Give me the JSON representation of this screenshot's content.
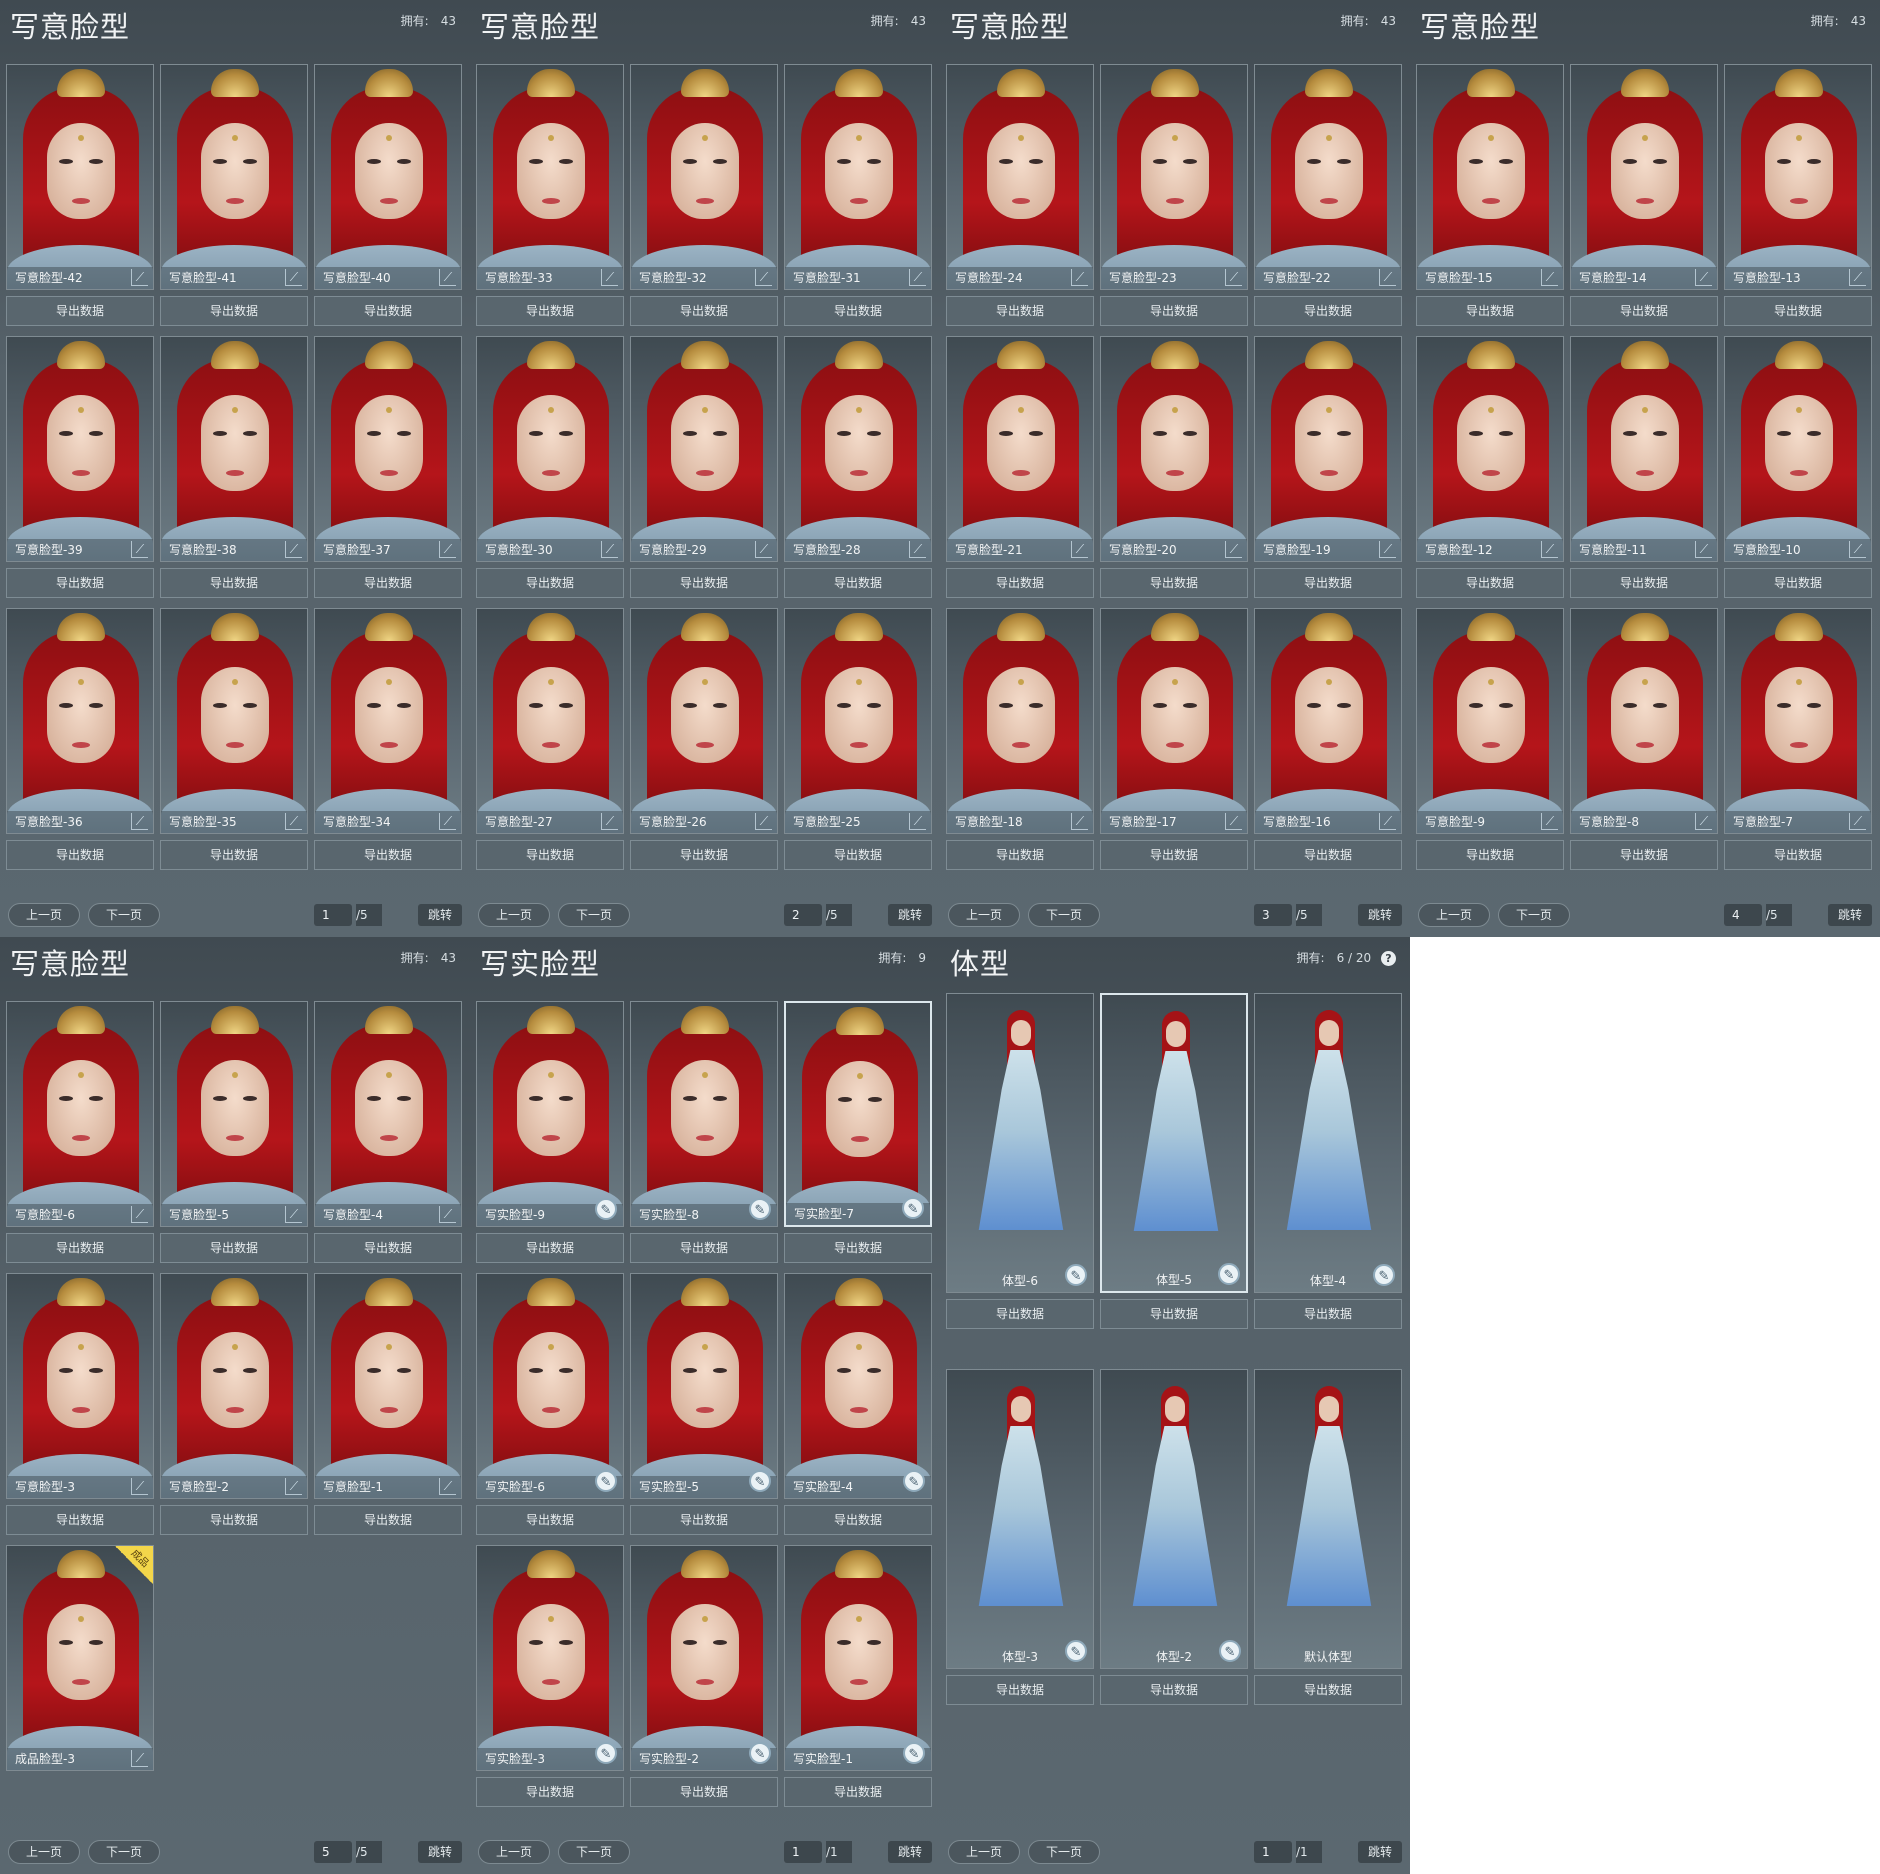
{
  "common": {
    "export_label": "导出数据",
    "prev_label": "上一页",
    "next_label": "下一页",
    "jump_label": "跳转",
    "owned_label": "拥有:"
  },
  "panels": [
    {
      "title": "写意脸型",
      "owned": "43",
      "page": "1",
      "total": "/5",
      "kind": "face",
      "items": [
        {
          "label": "写意脸型-42"
        },
        {
          "label": "写意脸型-41"
        },
        {
          "label": "写意脸型-40"
        },
        {
          "label": "写意脸型-39"
        },
        {
          "label": "写意脸型-38"
        },
        {
          "label": "写意脸型-37"
        },
        {
          "label": "写意脸型-36"
        },
        {
          "label": "写意脸型-35"
        },
        {
          "label": "写意脸型-34"
        }
      ]
    },
    {
      "title": "写意脸型",
      "owned": "43",
      "page": "2",
      "total": "/5",
      "kind": "face",
      "items": [
        {
          "label": "写意脸型-33"
        },
        {
          "label": "写意脸型-32"
        },
        {
          "label": "写意脸型-31"
        },
        {
          "label": "写意脸型-30"
        },
        {
          "label": "写意脸型-29"
        },
        {
          "label": "写意脸型-28"
        },
        {
          "label": "写意脸型-27"
        },
        {
          "label": "写意脸型-26"
        },
        {
          "label": "写意脸型-25"
        }
      ]
    },
    {
      "title": "写意脸型",
      "owned": "43",
      "page": "3",
      "total": "/5",
      "kind": "face",
      "items": [
        {
          "label": "写意脸型-24"
        },
        {
          "label": "写意脸型-23"
        },
        {
          "label": "写意脸型-22"
        },
        {
          "label": "写意脸型-21"
        },
        {
          "label": "写意脸型-20"
        },
        {
          "label": "写意脸型-19"
        },
        {
          "label": "写意脸型-18"
        },
        {
          "label": "写意脸型-17"
        },
        {
          "label": "写意脸型-16"
        }
      ]
    },
    {
      "title": "写意脸型",
      "owned": "43",
      "page": "4",
      "total": "/5",
      "kind": "face",
      "items": [
        {
          "label": "写意脸型-15"
        },
        {
          "label": "写意脸型-14"
        },
        {
          "label": "写意脸型-13"
        },
        {
          "label": "写意脸型-12"
        },
        {
          "label": "写意脸型-11"
        },
        {
          "label": "写意脸型-10"
        },
        {
          "label": "写意脸型-9"
        },
        {
          "label": "写意脸型-8"
        },
        {
          "label": "写意脸型-7"
        }
      ]
    },
    {
      "title": "写意脸型",
      "owned": "43",
      "page": "5",
      "total": "/5",
      "kind": "face",
      "items": [
        {
          "label": "写意脸型-6"
        },
        {
          "label": "写意脸型-5"
        },
        {
          "label": "写意脸型-4"
        },
        {
          "label": "写意脸型-3"
        },
        {
          "label": "写意脸型-2"
        },
        {
          "label": "写意脸型-1"
        },
        {
          "label": "成品脸型-3",
          "badge": "成品",
          "no_export": true
        }
      ]
    },
    {
      "title": "写实脸型",
      "owned": "9",
      "page": "1",
      "total": "/1",
      "kind": "face",
      "circle": true,
      "items": [
        {
          "label": "写实脸型-9"
        },
        {
          "label": "写实脸型-8"
        },
        {
          "label": "写实脸型-7",
          "selected": true
        },
        {
          "label": "写实脸型-6"
        },
        {
          "label": "写实脸型-5"
        },
        {
          "label": "写实脸型-4"
        },
        {
          "label": "写实脸型-3"
        },
        {
          "label": "写实脸型-2"
        },
        {
          "label": "写实脸型-1"
        }
      ]
    },
    {
      "title": "体型",
      "owned": "6 / 20",
      "page": "1",
      "total": "/1",
      "kind": "body",
      "circle": true,
      "help": "?",
      "items": [
        {
          "label": "体型-6"
        },
        {
          "label": "体型-5",
          "selected": true
        },
        {
          "label": "体型-4"
        },
        {
          "label": "体型-3"
        },
        {
          "label": "体型-2"
        },
        {
          "label": "默认体型",
          "no_edit": true
        }
      ]
    }
  ]
}
